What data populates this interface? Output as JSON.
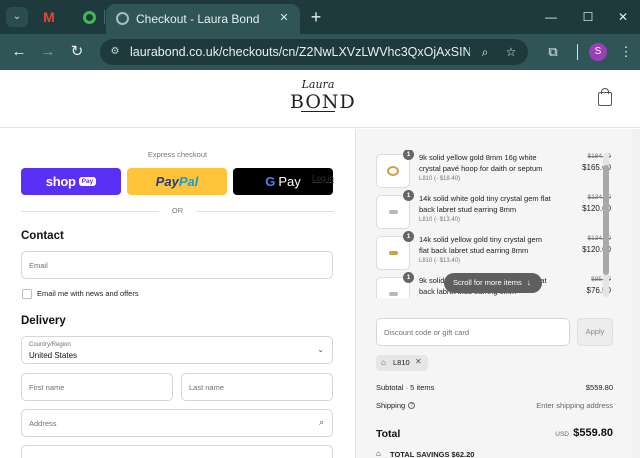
{
  "browser": {
    "tab_title": "Checkout - Laura Bond",
    "gmail_letter": "M",
    "url": "laurabond.co.uk/checkouts/cn/Z2NwLXVzLWVhc3QxOjAxSINGSIZ...",
    "profile_initial": "S"
  },
  "store": {
    "logo_script": "Laura",
    "logo_word": "BOND"
  },
  "checkout": {
    "express_label": "Express checkout",
    "shop_label": "shop",
    "shop_badge": "Pay",
    "paypal_a": "Pay",
    "paypal_b": "Pal",
    "gpay_g": "G",
    "gpay_label": "Pay",
    "or_label": "OR",
    "contact_heading": "Contact",
    "login_link": "Log in",
    "email_placeholder": "Email",
    "news_label": "Email me with news and offers",
    "delivery_heading": "Delivery",
    "country_label": "Country/Region",
    "country_value": "United States",
    "first_name_placeholder": "First name",
    "last_name_placeholder": "Last name",
    "address_placeholder": "Address"
  },
  "summary": {
    "items": [
      {
        "qty": "1",
        "name": "9k solid yellow gold 8mm 16g white crystal pavé hoop for daith or septum",
        "discount": "L810 (- $18.40)",
        "old_price": "$184.00",
        "price": "$165.60",
        "thumb": "hoop-gold"
      },
      {
        "qty": "1",
        "name": "14k solid white gold tiny crystal gem flat back labret stud earring 8mm",
        "discount": "L810 (- $13.40)",
        "old_price": "$134.00",
        "price": "$120.60",
        "thumb": "stud-silver"
      },
      {
        "qty": "1",
        "name": "14k solid yellow gold tiny crystal gem flat back labret stud earring 8mm",
        "discount": "L810 (- $13.40)",
        "old_price": "$134.00",
        "price": "$120.60",
        "thumb": "stud-gold"
      },
      {
        "qty": "1",
        "name": "9k solid white gold tiny crystal gem flat back labret stud earring 6mm",
        "discount": "",
        "old_price": "$85.00",
        "price": "$76.50",
        "thumb": "stud-silver"
      }
    ],
    "scroll_hint": "Scroll for more items",
    "discount_placeholder": "Discount code or gift card",
    "apply_label": "Apply",
    "applied_code": "L810",
    "subtotal_label": "Subtotal · 5 items",
    "subtotal_value": "$559.80",
    "shipping_label": "Shipping",
    "shipping_value": "Enter shipping address",
    "total_label": "Total",
    "currency": "USD",
    "total_value": "$559.80",
    "savings_label": "TOTAL SAVINGS  $62.20"
  }
}
